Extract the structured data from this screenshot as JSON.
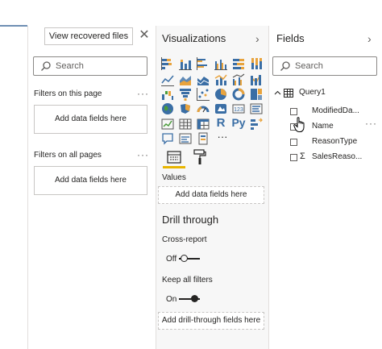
{
  "recover": {
    "label": "View recovered files"
  },
  "filters": {
    "search_placeholder": "Search",
    "on_page_label": "Filters on this page",
    "on_page_drop": "Add data fields here",
    "all_pages_label": "Filters on all pages",
    "all_pages_drop": "Add data fields here",
    "more": "···"
  },
  "visualizations": {
    "title": "Visualizations",
    "more_visuals": "···",
    "r_label": "R",
    "py_label": "Py",
    "values_label": "Values",
    "values_drop": "Add data fields here",
    "drill_title": "Drill through",
    "cross_report_label": "Cross-report",
    "cross_report_state": "Off",
    "keep_filters_label": "Keep all filters",
    "keep_filters_state": "On",
    "drill_drop": "Add drill-through fields here"
  },
  "fields": {
    "title": "Fields",
    "search_placeholder": "Search",
    "table_name": "Query1",
    "items": [
      {
        "label": "ModifiedDa...",
        "checked": false,
        "sigma": false
      },
      {
        "label": "Name",
        "checked": false,
        "sigma": false
      },
      {
        "label": "ReasonType",
        "checked": false,
        "sigma": false
      },
      {
        "label": "SalesReaso...",
        "checked": false,
        "sigma": true
      }
    ],
    "more": "···"
  },
  "colors": {
    "accent_yellow": "#e8b500",
    "viz_blue": "#3a6ea5",
    "viz_orange": "#e8a33d",
    "viz_green": "#4a9c3b"
  }
}
